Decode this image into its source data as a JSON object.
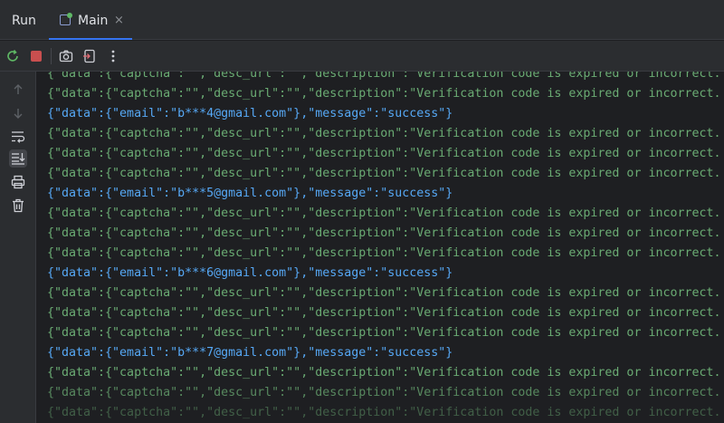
{
  "tabbar": {
    "run_label": "Run",
    "tab": {
      "label": "Main",
      "close": "×"
    }
  },
  "toolbar": {
    "icons": [
      "rerun-icon",
      "stop-icon",
      "camera-icon",
      "exit-icon",
      "more-icon"
    ]
  },
  "sidebar": {
    "icons": [
      "arrow-up-icon",
      "arrow-down-icon",
      "soft-wrap-icon",
      "scroll-to-end-icon",
      "print-icon",
      "trash-icon"
    ]
  },
  "colors": {
    "error_text": "#6aab73",
    "success_text": "#56a8f5",
    "accent": "#3574f0"
  },
  "console": {
    "lines": [
      {
        "type": "error",
        "text": "{\"data\":{\"captcha\":\"\",\"desc_url\":\"\",\"description\":\"Verification code is expired or incorrect."
      },
      {
        "type": "error",
        "text": "{\"data\":{\"captcha\":\"\",\"desc_url\":\"\",\"description\":\"Verification code is expired or incorrect."
      },
      {
        "type": "success",
        "text": "{\"data\":{\"email\":\"b***4@gmail.com\"},\"message\":\"success\"}"
      },
      {
        "type": "error",
        "text": "{\"data\":{\"captcha\":\"\",\"desc_url\":\"\",\"description\":\"Verification code is expired or incorrect."
      },
      {
        "type": "error",
        "text": "{\"data\":{\"captcha\":\"\",\"desc_url\":\"\",\"description\":\"Verification code is expired or incorrect."
      },
      {
        "type": "error",
        "text": "{\"data\":{\"captcha\":\"\",\"desc_url\":\"\",\"description\":\"Verification code is expired or incorrect."
      },
      {
        "type": "success",
        "text": "{\"data\":{\"email\":\"b***5@gmail.com\"},\"message\":\"success\"}"
      },
      {
        "type": "error",
        "text": "{\"data\":{\"captcha\":\"\",\"desc_url\":\"\",\"description\":\"Verification code is expired or incorrect."
      },
      {
        "type": "error",
        "text": "{\"data\":{\"captcha\":\"\",\"desc_url\":\"\",\"description\":\"Verification code is expired or incorrect."
      },
      {
        "type": "error",
        "text": "{\"data\":{\"captcha\":\"\",\"desc_url\":\"\",\"description\":\"Verification code is expired or incorrect."
      },
      {
        "type": "success",
        "text": "{\"data\":{\"email\":\"b***6@gmail.com\"},\"message\":\"success\"}"
      },
      {
        "type": "error",
        "text": "{\"data\":{\"captcha\":\"\",\"desc_url\":\"\",\"description\":\"Verification code is expired or incorrect."
      },
      {
        "type": "error",
        "text": "{\"data\":{\"captcha\":\"\",\"desc_url\":\"\",\"description\":\"Verification code is expired or incorrect."
      },
      {
        "type": "error",
        "text": "{\"data\":{\"captcha\":\"\",\"desc_url\":\"\",\"description\":\"Verification code is expired or incorrect."
      },
      {
        "type": "success",
        "text": "{\"data\":{\"email\":\"b***7@gmail.com\"},\"message\":\"success\"}"
      },
      {
        "type": "error",
        "text": "{\"data\":{\"captcha\":\"\",\"desc_url\":\"\",\"description\":\"Verification code is expired or incorrect."
      },
      {
        "type": "error",
        "text": "{\"data\":{\"captcha\":\"\",\"desc_url\":\"\",\"description\":\"Verification code is expired or incorrect."
      },
      {
        "type": "error",
        "text": "{\"data\":{\"captcha\":\"\",\"desc_url\":\"\",\"description\":\"Verification code is expired or incorrect."
      }
    ]
  }
}
